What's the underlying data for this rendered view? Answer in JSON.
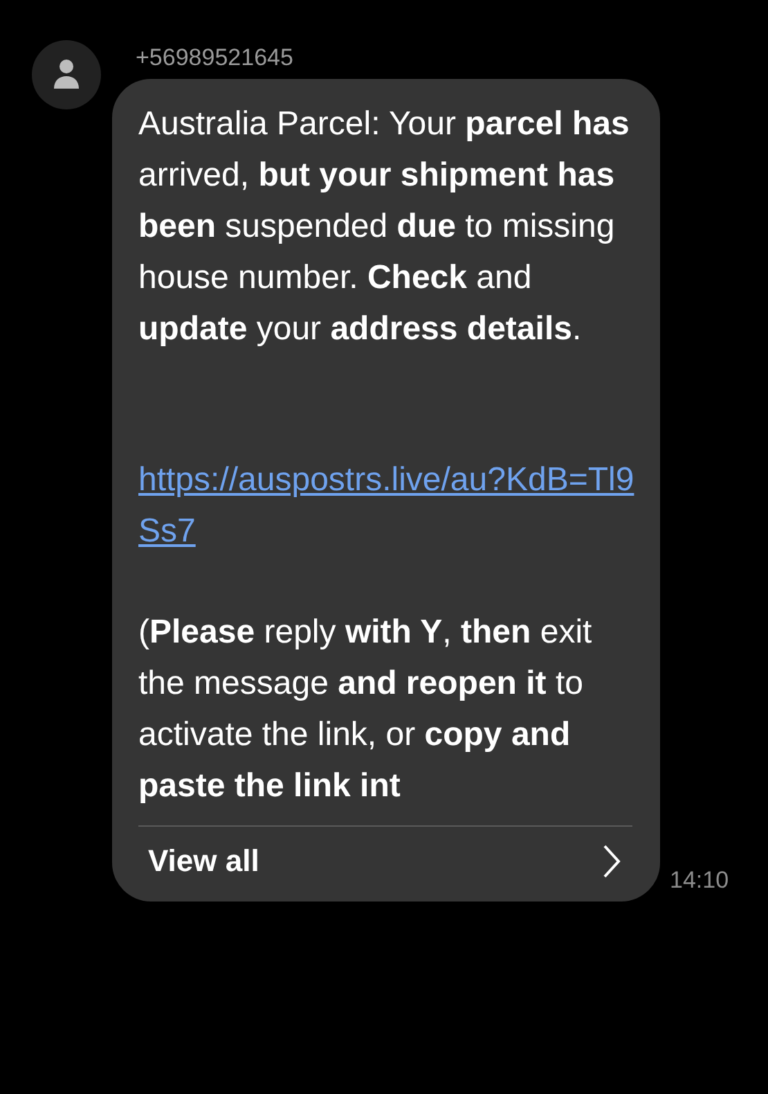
{
  "sender": {
    "number": "+56989521645"
  },
  "message": {
    "paragraphs": [
      {
        "kind": "text",
        "text": "Australia Parcel: Your **parcel has** arrived, **but your shipment has been** suspended **due** to missing house number.  **Check** and **update** your **address details**."
      },
      {
        "kind": "link",
        "text": "https://auspostrs.live/au?KdB=Tl9Ss7"
      },
      {
        "kind": "text",
        "text": "(**Please** reply **with Y**, **then** exit the message **and reopen it** to activate the link, or **copy and paste the link int**"
      }
    ],
    "view_all": "View all",
    "time": "14:10"
  }
}
